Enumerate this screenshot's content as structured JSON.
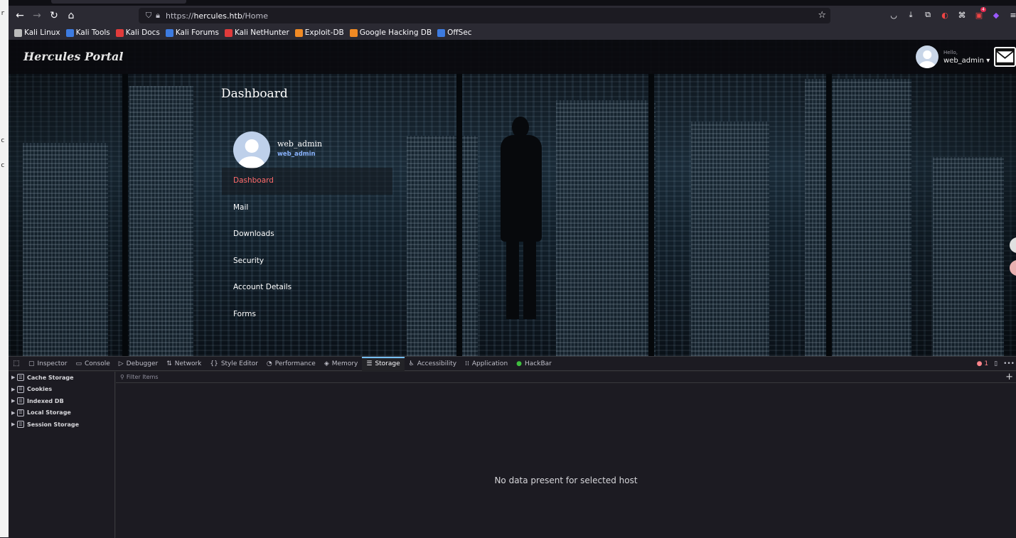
{
  "desktop_strip": [
    "r",
    "c",
    "c",
    "c"
  ],
  "browser": {
    "nav": {
      "back_icon": "arrow-left-icon",
      "forward_icon": "arrow-right-icon",
      "reload_icon": "reload-icon",
      "home_icon": "home-icon",
      "url_prefix": "https://",
      "url_host": "hercules.htb",
      "url_path": "/Home"
    },
    "bookmarks": [
      {
        "label": "Kali Linux",
        "icon": "kali-icon",
        "color": "#bbbbbb"
      },
      {
        "label": "Kali Tools",
        "icon": "kali-tools-icon",
        "color": "#3d7be0"
      },
      {
        "label": "Kali Docs",
        "icon": "kali-docs-icon",
        "color": "#e03b3b"
      },
      {
        "label": "Kali Forums",
        "icon": "kali-forums-icon",
        "color": "#3d7be0"
      },
      {
        "label": "Kali NetHunter",
        "icon": "nethunter-icon",
        "color": "#e03b3b"
      },
      {
        "label": "Exploit-DB",
        "icon": "exploit-db-icon",
        "color": "#f08a24"
      },
      {
        "label": "Google Hacking DB",
        "icon": "ghdb-icon",
        "color": "#f08a24"
      },
      {
        "label": "OffSec",
        "icon": "offsec-icon",
        "color": "#3d7be0"
      }
    ],
    "toolbar_badge": "4"
  },
  "site": {
    "title": "Hercules Portal",
    "hello": "Hello,",
    "user_menu": "web_admin ▾",
    "dashboard_title": "Dashboard",
    "profile_name": "web_admin",
    "profile_handle": "web_admin",
    "sidebar": [
      {
        "label": "Dashboard",
        "active": true
      },
      {
        "label": "Mail",
        "active": false
      },
      {
        "label": "Downloads",
        "active": false
      },
      {
        "label": "Security",
        "active": false
      },
      {
        "label": "Account Details",
        "active": false
      },
      {
        "label": "Forms",
        "active": false
      }
    ]
  },
  "devtools": {
    "tabs": [
      {
        "label": "Inspector",
        "icon": "inspector-icon",
        "glyph": "▢"
      },
      {
        "label": "Console",
        "icon": "console-icon",
        "glyph": "▭"
      },
      {
        "label": "Debugger",
        "icon": "debugger-icon",
        "glyph": "▷"
      },
      {
        "label": "Network",
        "icon": "network-icon",
        "glyph": "⇅"
      },
      {
        "label": "Style Editor",
        "icon": "style-editor-icon",
        "glyph": "{}"
      },
      {
        "label": "Performance",
        "icon": "performance-icon",
        "glyph": "◔"
      },
      {
        "label": "Memory",
        "icon": "memory-icon",
        "glyph": "◈"
      },
      {
        "label": "Storage",
        "icon": "storage-icon",
        "glyph": "☰",
        "active": true
      },
      {
        "label": "Accessibility",
        "icon": "accessibility-icon",
        "glyph": "♿"
      },
      {
        "label": "Application",
        "icon": "application-icon",
        "glyph": "⁞⁞"
      },
      {
        "label": "HackBar",
        "icon": "hackbar-icon",
        "glyph": "●"
      }
    ],
    "error_count": "1",
    "storage_tree": [
      "Cache Storage",
      "Cookies",
      "Indexed DB",
      "Local Storage",
      "Session Storage"
    ],
    "filter_placeholder": "Filter Items",
    "empty_message": "No data present for selected host"
  }
}
